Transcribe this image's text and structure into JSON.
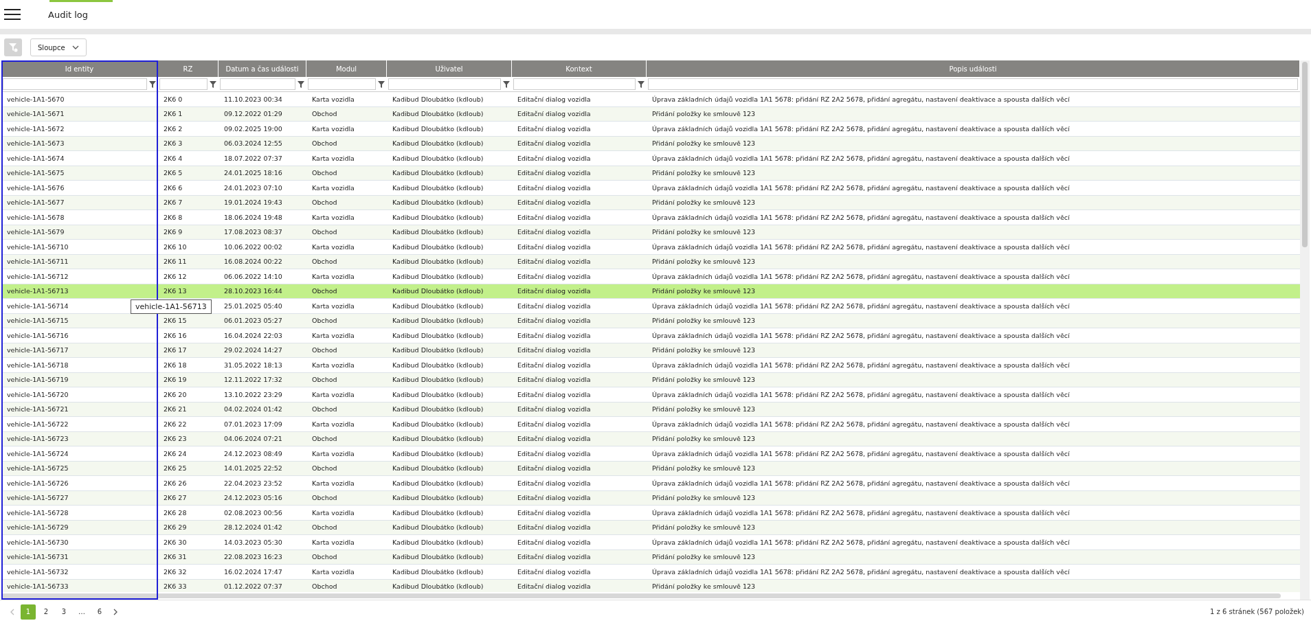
{
  "header": {
    "title": "Audit log"
  },
  "toolbar": {
    "columns_button": "Sloupce"
  },
  "table": {
    "columns": [
      {
        "label": "Id entity",
        "filterable": true,
        "focused": true
      },
      {
        "label": "RZ",
        "filterable": true,
        "focused": false
      },
      {
        "label": "Datum a čas události",
        "filterable": true,
        "focused": false
      },
      {
        "label": "Modul",
        "filterable": true,
        "focused": false
      },
      {
        "label": "Uživatel",
        "filterable": true,
        "focused": false
      },
      {
        "label": "Kontext",
        "filterable": true,
        "focused": false
      },
      {
        "label": "Popis události",
        "filterable": false,
        "focused": false
      }
    ],
    "rows": [
      {
        "selected": false,
        "cells": [
          "vehicle-1A1-5670",
          "2K6 0",
          "11.10.2023 00:34",
          "Karta vozidla",
          "Kadibud Dloubátko (kdloub)",
          "Editační dialog vozidla",
          "Úprava základních údajů vozidla 1A1 5678: přidání RZ 2A2 5678, přidání agregátu, nastavení deaktivace a spousta dalších věcí"
        ]
      },
      {
        "selected": false,
        "cells": [
          "vehicle-1A1-5671",
          "2K6 1",
          "09.12.2022 01:29",
          "Obchod",
          "Kadibud Dloubátko (kdloub)",
          "Editační dialog vozidla",
          "Přidání položky ke smlouvě 123"
        ]
      },
      {
        "selected": false,
        "cells": [
          "vehicle-1A1-5672",
          "2K6 2",
          "09.02.2025 19:00",
          "Karta vozidla",
          "Kadibud Dloubátko (kdloub)",
          "Editační dialog vozidla",
          "Úprava základních údajů vozidla 1A1 5678: přidání RZ 2A2 5678, přidání agregátu, nastavení deaktivace a spousta dalších věcí"
        ]
      },
      {
        "selected": false,
        "cells": [
          "vehicle-1A1-5673",
          "2K6 3",
          "06.03.2024 12:55",
          "Obchod",
          "Kadibud Dloubátko (kdloub)",
          "Editační dialog vozidla",
          "Přidání položky ke smlouvě 123"
        ]
      },
      {
        "selected": false,
        "cells": [
          "vehicle-1A1-5674",
          "2K6 4",
          "18.07.2022 07:37",
          "Karta vozidla",
          "Kadibud Dloubátko (kdloub)",
          "Editační dialog vozidla",
          "Úprava základních údajů vozidla 1A1 5678: přidání RZ 2A2 5678, přidání agregátu, nastavení deaktivace a spousta dalších věcí"
        ]
      },
      {
        "selected": false,
        "cells": [
          "vehicle-1A1-5675",
          "2K6 5",
          "24.01.2025 18:16",
          "Obchod",
          "Kadibud Dloubátko (kdloub)",
          "Editační dialog vozidla",
          "Přidání položky ke smlouvě 123"
        ]
      },
      {
        "selected": false,
        "cells": [
          "vehicle-1A1-5676",
          "2K6 6",
          "24.01.2023 07:10",
          "Karta vozidla",
          "Kadibud Dloubátko (kdloub)",
          "Editační dialog vozidla",
          "Úprava základních údajů vozidla 1A1 5678: přidání RZ 2A2 5678, přidání agregátu, nastavení deaktivace a spousta dalších věcí"
        ]
      },
      {
        "selected": false,
        "cells": [
          "vehicle-1A1-5677",
          "2K6 7",
          "19.01.2024 19:43",
          "Obchod",
          "Kadibud Dloubátko (kdloub)",
          "Editační dialog vozidla",
          "Přidání položky ke smlouvě 123"
        ]
      },
      {
        "selected": false,
        "cells": [
          "vehicle-1A1-5678",
          "2K6 8",
          "18.06.2024 19:48",
          "Karta vozidla",
          "Kadibud Dloubátko (kdloub)",
          "Editační dialog vozidla",
          "Úprava základních údajů vozidla 1A1 5678: přidání RZ 2A2 5678, přidání agregátu, nastavení deaktivace a spousta dalších věcí"
        ]
      },
      {
        "selected": false,
        "cells": [
          "vehicle-1A1-5679",
          "2K6 9",
          "17.08.2023 08:37",
          "Obchod",
          "Kadibud Dloubátko (kdloub)",
          "Editační dialog vozidla",
          "Přidání položky ke smlouvě 123"
        ]
      },
      {
        "selected": false,
        "cells": [
          "vehicle-1A1-56710",
          "2K6 10",
          "10.06.2022 00:02",
          "Karta vozidla",
          "Kadibud Dloubátko (kdloub)",
          "Editační dialog vozidla",
          "Úprava základních údajů vozidla 1A1 5678: přidání RZ 2A2 5678, přidání agregátu, nastavení deaktivace a spousta dalších věcí"
        ]
      },
      {
        "selected": false,
        "cells": [
          "vehicle-1A1-56711",
          "2K6 11",
          "16.08.2024 00:22",
          "Obchod",
          "Kadibud Dloubátko (kdloub)",
          "Editační dialog vozidla",
          "Přidání položky ke smlouvě 123"
        ]
      },
      {
        "selected": false,
        "cells": [
          "vehicle-1A1-56712",
          "2K6 12",
          "06.06.2022 14:10",
          "Karta vozidla",
          "Kadibud Dloubátko (kdloub)",
          "Editační dialog vozidla",
          "Úprava základních údajů vozidla 1A1 5678: přidání RZ 2A2 5678, přidání agregátu, nastavení deaktivace a spousta dalších věcí"
        ]
      },
      {
        "selected": true,
        "cells": [
          "vehicle-1A1-56713",
          "2K6 13",
          "28.10.2023 16:44",
          "Obchod",
          "Kadibud Dloubátko (kdloub)",
          "Editační dialog vozidla",
          "Přidání položky ke smlouvě 123"
        ]
      },
      {
        "selected": false,
        "cells": [
          "vehicle-1A1-56714",
          null,
          "25.01.2025 05:40",
          "Karta vozidla",
          "Kadibud Dloubátko (kdloub)",
          "Editační dialog vozidla",
          "Úprava základních údajů vozidla 1A1 5678: přidání RZ 2A2 5678, přidání agregátu, nastavení deaktivace a spousta dalších věcí"
        ]
      },
      {
        "selected": false,
        "cells": [
          "vehicle-1A1-56715",
          "2K6 15",
          "06.01.2023 05:27",
          "Obchod",
          "Kadibud Dloubátko (kdloub)",
          "Editační dialog vozidla",
          "Přidání položky ke smlouvě 123"
        ]
      },
      {
        "selected": false,
        "cells": [
          "vehicle-1A1-56716",
          "2K6 16",
          "16.04.2024 22:03",
          "Karta vozidla",
          "Kadibud Dloubátko (kdloub)",
          "Editační dialog vozidla",
          "Úprava základních údajů vozidla 1A1 5678: přidání RZ 2A2 5678, přidání agregátu, nastavení deaktivace a spousta dalších věcí"
        ]
      },
      {
        "selected": false,
        "cells": [
          "vehicle-1A1-56717",
          "2K6 17",
          "29.02.2024 14:27",
          "Obchod",
          "Kadibud Dloubátko (kdloub)",
          "Editační dialog vozidla",
          "Přidání položky ke smlouvě 123"
        ]
      },
      {
        "selected": false,
        "cells": [
          "vehicle-1A1-56718",
          "2K6 18",
          "31.05.2022 18:13",
          "Karta vozidla",
          "Kadibud Dloubátko (kdloub)",
          "Editační dialog vozidla",
          "Úprava základních údajů vozidla 1A1 5678: přidání RZ 2A2 5678, přidání agregátu, nastavení deaktivace a spousta dalších věcí"
        ]
      },
      {
        "selected": false,
        "cells": [
          "vehicle-1A1-56719",
          "2K6 19",
          "12.11.2022 17:32",
          "Obchod",
          "Kadibud Dloubátko (kdloub)",
          "Editační dialog vozidla",
          "Přidání položky ke smlouvě 123"
        ]
      },
      {
        "selected": false,
        "cells": [
          "vehicle-1A1-56720",
          "2K6 20",
          "13.10.2022 23:29",
          "Karta vozidla",
          "Kadibud Dloubátko (kdloub)",
          "Editační dialog vozidla",
          "Úprava základních údajů vozidla 1A1 5678: přidání RZ 2A2 5678, přidání agregátu, nastavení deaktivace a spousta dalších věcí"
        ]
      },
      {
        "selected": false,
        "cells": [
          "vehicle-1A1-56721",
          "2K6 21",
          "04.02.2024 01:42",
          "Obchod",
          "Kadibud Dloubátko (kdloub)",
          "Editační dialog vozidla",
          "Přidání položky ke smlouvě 123"
        ]
      },
      {
        "selected": false,
        "cells": [
          "vehicle-1A1-56722",
          "2K6 22",
          "07.01.2023 17:09",
          "Karta vozidla",
          "Kadibud Dloubátko (kdloub)",
          "Editační dialog vozidla",
          "Úprava základních údajů vozidla 1A1 5678: přidání RZ 2A2 5678, přidání agregátu, nastavení deaktivace a spousta dalších věcí"
        ]
      },
      {
        "selected": false,
        "cells": [
          "vehicle-1A1-56723",
          "2K6 23",
          "04.06.2024 07:21",
          "Obchod",
          "Kadibud Dloubátko (kdloub)",
          "Editační dialog vozidla",
          "Přidání položky ke smlouvě 123"
        ]
      },
      {
        "selected": false,
        "cells": [
          "vehicle-1A1-56724",
          "2K6 24",
          "24.12.2023 08:49",
          "Karta vozidla",
          "Kadibud Dloubátko (kdloub)",
          "Editační dialog vozidla",
          "Úprava základních údajů vozidla 1A1 5678: přidání RZ 2A2 5678, přidání agregátu, nastavení deaktivace a spousta dalších věcí"
        ]
      },
      {
        "selected": false,
        "cells": [
          "vehicle-1A1-56725",
          "2K6 25",
          "14.01.2025 22:52",
          "Obchod",
          "Kadibud Dloubátko (kdloub)",
          "Editační dialog vozidla",
          "Přidání položky ke smlouvě 123"
        ]
      },
      {
        "selected": false,
        "cells": [
          "vehicle-1A1-56726",
          "2K6 26",
          "22.04.2023 23:52",
          "Karta vozidla",
          "Kadibud Dloubátko (kdloub)",
          "Editační dialog vozidla",
          "Úprava základních údajů vozidla 1A1 5678: přidání RZ 2A2 5678, přidání agregátu, nastavení deaktivace a spousta dalších věcí"
        ]
      },
      {
        "selected": false,
        "cells": [
          "vehicle-1A1-56727",
          "2K6 27",
          "24.12.2023 05:16",
          "Obchod",
          "Kadibud Dloubátko (kdloub)",
          "Editační dialog vozidla",
          "Přidání položky ke smlouvě 123"
        ]
      },
      {
        "selected": false,
        "cells": [
          "vehicle-1A1-56728",
          "2K6 28",
          "02.08.2023 00:56",
          "Karta vozidla",
          "Kadibud Dloubátko (kdloub)",
          "Editační dialog vozidla",
          "Úprava základních údajů vozidla 1A1 5678: přidání RZ 2A2 5678, přidání agregátu, nastavení deaktivace a spousta dalších věcí"
        ]
      },
      {
        "selected": false,
        "cells": [
          "vehicle-1A1-56729",
          "2K6 29",
          "28.12.2024 01:42",
          "Obchod",
          "Kadibud Dloubátko (kdloub)",
          "Editační dialog vozidla",
          "Přidání položky ke smlouvě 123"
        ]
      },
      {
        "selected": false,
        "cells": [
          "vehicle-1A1-56730",
          "2K6 30",
          "14.03.2023 05:30",
          "Karta vozidla",
          "Kadibud Dloubátko (kdloub)",
          "Editační dialog vozidla",
          "Úprava základních údajů vozidla 1A1 5678: přidání RZ 2A2 5678, přidání agregátu, nastavení deaktivace a spousta dalších věcí"
        ]
      },
      {
        "selected": false,
        "cells": [
          "vehicle-1A1-56731",
          "2K6 31",
          "22.08.2023 16:23",
          "Obchod",
          "Kadibud Dloubátko (kdloub)",
          "Editační dialog vozidla",
          "Přidání položky ke smlouvě 123"
        ]
      },
      {
        "selected": false,
        "cells": [
          "vehicle-1A1-56732",
          "2K6 32",
          "16.02.2024 17:47",
          "Karta vozidla",
          "Kadibud Dloubátko (kdloub)",
          "Editační dialog vozidla",
          "Úprava základních údajů vozidla 1A1 5678: přidání RZ 2A2 5678, přidání agregátu, nastavení deaktivace a spousta dalších věcí"
        ]
      },
      {
        "selected": false,
        "cells": [
          "vehicle-1A1-56733",
          "2K6 33",
          "01.12.2022 07:37",
          "Obchod",
          "Kadibud Dloubátko (kdloub)",
          "Editační dialog vozidla",
          "Přidání položky ke smlouvě 123"
        ]
      }
    ]
  },
  "tooltip": {
    "text": "vehicle-1A1-56713"
  },
  "pagination": {
    "pages": [
      {
        "label": "1",
        "selected": true
      },
      {
        "label": "2",
        "selected": false
      },
      {
        "label": "3",
        "selected": false
      },
      {
        "label": "…",
        "selected": false
      },
      {
        "label": "6",
        "selected": false
      }
    ],
    "info": "1 z 6 stránek (567 položek)"
  }
}
